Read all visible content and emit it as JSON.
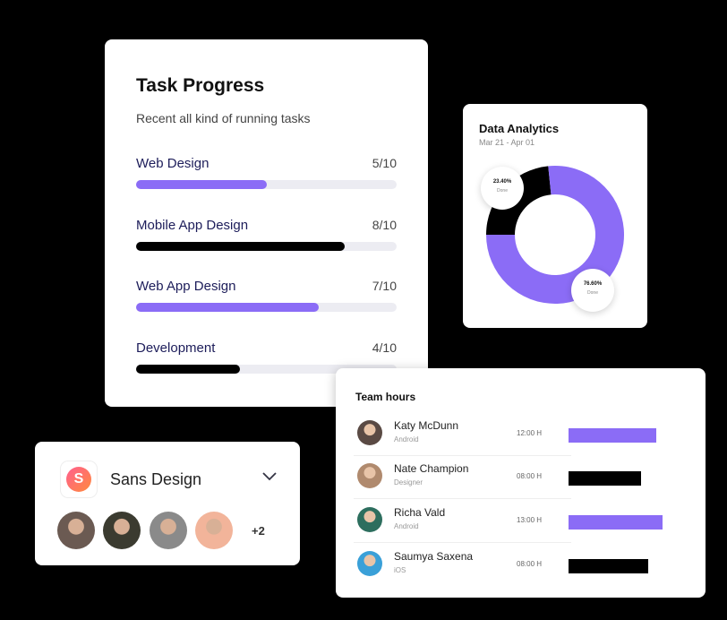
{
  "task_progress": {
    "title": "Task Progress",
    "subtitle": "Recent all kind of running tasks",
    "tasks": [
      {
        "name": "Web Design",
        "count": "5/10",
        "progress": 0.5,
        "color": "#8b6cf6"
      },
      {
        "name": "Mobile App Design",
        "count": "8/10",
        "progress": 0.8,
        "color": "#000000"
      },
      {
        "name": "Web App Design",
        "count": "7/10",
        "progress": 0.7,
        "color": "#8b6cf6"
      },
      {
        "name": "Development",
        "count": "4/10",
        "progress": 0.4,
        "color": "#000000"
      }
    ]
  },
  "analytics": {
    "title": "Data Analytics",
    "date_range": "Mar 21 - Apr 01",
    "segments": [
      {
        "percent": "23.40%",
        "label": "Done",
        "value": 23.4,
        "color": "#000000"
      },
      {
        "percent": "76.60%",
        "label": "Done",
        "value": 76.6,
        "color": "#8b6cf6"
      }
    ]
  },
  "team": {
    "title": "Team hours",
    "members": [
      {
        "name": "Katy McDunn",
        "role": "Android",
        "hours": "12:00 H",
        "bar_fraction": 0.93,
        "color": "#8b6cf6",
        "avatar_color": "#5a4a44"
      },
      {
        "name": "Nate Champion",
        "role": "Designer",
        "hours": "08:00 H",
        "bar_fraction": 0.77,
        "color": "#000000",
        "avatar_color": "#b08a6e"
      },
      {
        "name": "Richa Vald",
        "role": "Android",
        "hours": "13:00 H",
        "bar_fraction": 1.0,
        "color": "#8b6cf6",
        "avatar_color": "#2d6e5e"
      },
      {
        "name": "Saumya Saxena",
        "role": "iOS",
        "hours": "08:00 H",
        "bar_fraction": 0.85,
        "color": "#000000",
        "avatar_color": "#3aa0d8"
      }
    ]
  },
  "workspace": {
    "logo_letter": "S",
    "name": "Sans Design",
    "more_count": "+2",
    "people_colors": [
      "#6b5a52",
      "#3b3b30",
      "#8a8a8a",
      "#f2b49a"
    ]
  }
}
